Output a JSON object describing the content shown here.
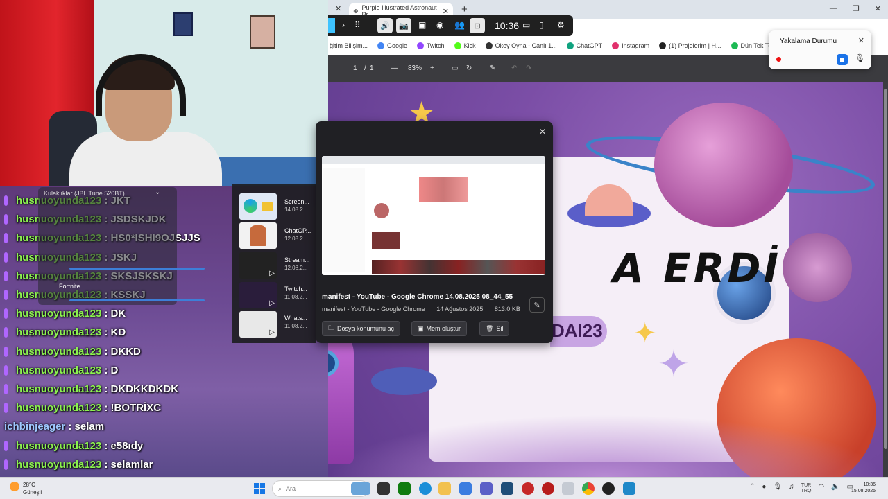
{
  "browser": {
    "tab_title": "Purple Illustrated Astronaut Pr...",
    "bookmarks": [
      {
        "label": "ğitim Bilişim...",
        "color": "#2a7de1"
      },
      {
        "label": "Google",
        "color": "#4285f4"
      },
      {
        "label": "Twitch",
        "color": "#9146ff"
      },
      {
        "label": "Kick",
        "color": "#53fc18"
      },
      {
        "label": "Okey Oyna - Canlı 1...",
        "color": "#333333"
      },
      {
        "label": "ChatGPT",
        "color": "#10a37f"
      },
      {
        "label": "Instagram",
        "color": "#e1306c"
      },
      {
        "label": "(1) Projelerim | H...",
        "color": "#222222"
      },
      {
        "label": "Dün Tek Tek • Hadise",
        "color": "#1db954"
      }
    ]
  },
  "pdf_toolbar": {
    "page_current": "1",
    "page_sep": "/",
    "page_total": "1",
    "zoom": "83%",
    "minus": "—",
    "plus": "+"
  },
  "capture_toolbar": {
    "time": "10:36"
  },
  "recording_panel": {
    "title": "Yakalama Durumu",
    "close": "✕"
  },
  "chat": {
    "messages": [
      {
        "user": "husnuoyunda123",
        "text": "JKT"
      },
      {
        "user": "husnuoyunda123",
        "text": "JSDSKJDK"
      },
      {
        "user": "husnuoyunda123",
        "text": "HS0*ISHI9OJSJJS"
      },
      {
        "user": "husnuoyunda123",
        "text": "JSKJ"
      },
      {
        "user": "husnuoyunda123",
        "text": "SKSJSKSKJ"
      },
      {
        "user": "husnuoyunda123",
        "text": "KSSKJ"
      },
      {
        "user": "husnuoyunda123",
        "text": "DK"
      },
      {
        "user": "husnuoyunda123",
        "text": "KD"
      },
      {
        "user": "husnuoyunda123",
        "text": "DKKD"
      },
      {
        "user": "husnuoyunda123",
        "text": "D"
      },
      {
        "user": "husnuoyunda123",
        "text": "DKDKKDKDK"
      },
      {
        "user": "husnuoyunda123",
        "text": "!BOTRİXC"
      },
      {
        "user": "ichbinjeager",
        "text": "selam"
      },
      {
        "user": "husnuoyunda123",
        "text": "e58ıdy"
      },
      {
        "user": "husnuoyunda123",
        "text": "selamlar"
      }
    ],
    "audio_device": "Kulaklıklar (JBL Tune 520BT)",
    "fortnite_label": "Fortnite"
  },
  "thumbnails": [
    {
      "title": "Screen...",
      "date": "14.08.2..."
    },
    {
      "title": "ChatGP...",
      "date": "12.08.2..."
    },
    {
      "title": "Stream...",
      "date": "12.08.2..."
    },
    {
      "title": "Twitch...",
      "date": "11.08.2..."
    },
    {
      "title": "Whats...",
      "date": "11.08.2..."
    }
  ],
  "preview": {
    "title": "manifest - YouTube - Google Chrome 14.08.2025 08_44_55",
    "subtitle": "manifest - YouTube - Google Chrome",
    "date": "14 Ağustos 2025",
    "size": "813.0 KB",
    "btn_location": "Dosya konumunu aç",
    "btn_meme": "Mem oluştur",
    "btn_delete": "Sil"
  },
  "scene": {
    "heading": "A ERDİ",
    "name_fragment": "DAI23"
  },
  "taskbar": {
    "temp": "28°C",
    "weather": "Güneşli",
    "search_placeholder": "Ara",
    "lang_top": "TUR",
    "lang_bottom": "TRQ",
    "time": "10:36",
    "date": "15.08.2025"
  }
}
